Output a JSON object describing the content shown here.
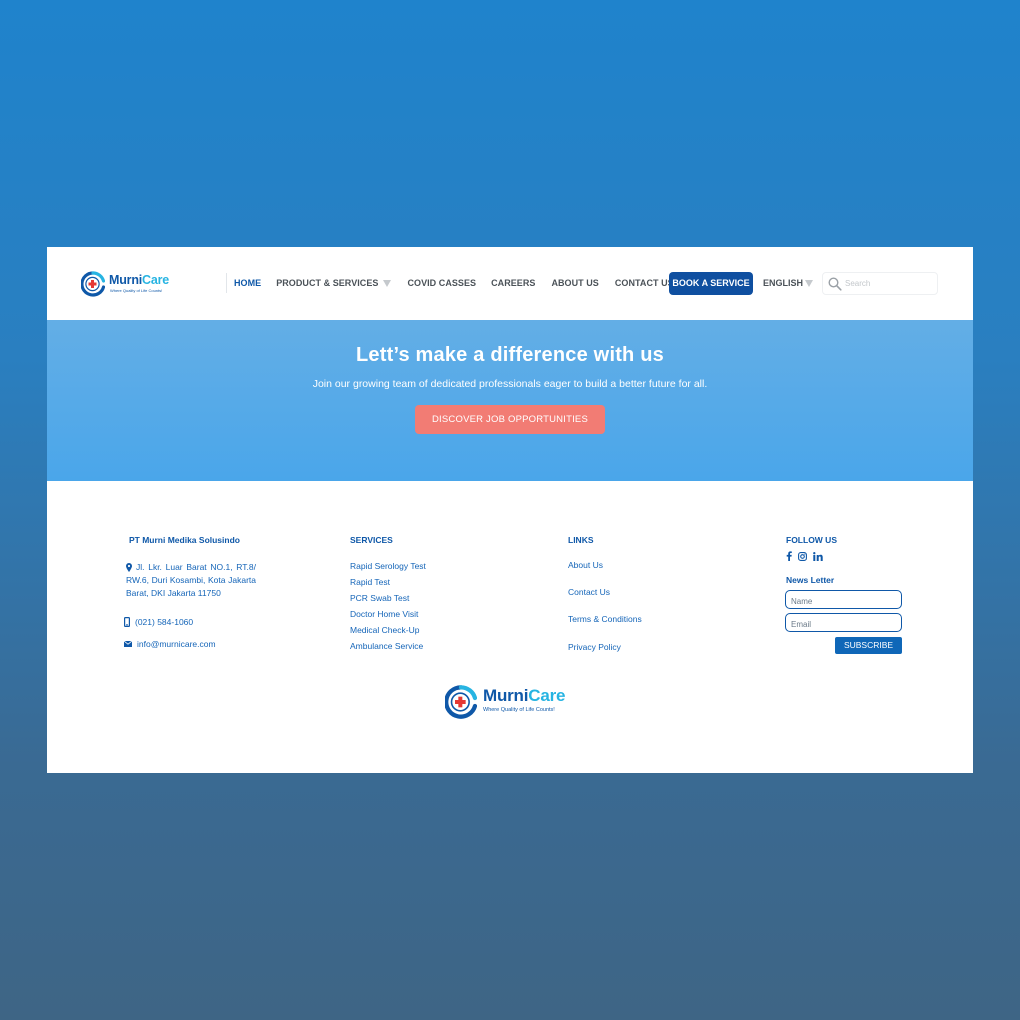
{
  "brand": {
    "name_part1": "Murni",
    "name_part2": "Care",
    "tagline": "Where Quality of Life Counts!"
  },
  "nav": {
    "items": [
      {
        "label": "HOME",
        "active": true
      },
      {
        "label": "PRODUCT & SERVICES",
        "dropdown": true
      },
      {
        "label": "COVID CASSES"
      },
      {
        "label": "CAREERS"
      },
      {
        "label": "ABOUT US"
      },
      {
        "label": "CONTACT US"
      }
    ],
    "book_label": "BOOK A SERVICE",
    "language": "ENGLISH",
    "search_placeholder": "Search"
  },
  "hero": {
    "title": "Lett’s make a difference with us",
    "subtitle": "Join our growing team of dedicated professionals eager to build a better future for all.",
    "cta": "DISCOVER JOB OPPORTUNITIES"
  },
  "footer": {
    "company": {
      "name": "PT Murni Medika Solusindo",
      "address": "Jl. Lkr. Luar Barat NO.1, RT.8/ RW.6, Duri Kosambi, Kota Jakarta Barat, DKI Jakarta 11750",
      "phone": "(021) 584-1060",
      "email": "info@murnicare.com"
    },
    "services": {
      "heading": "SERVICES",
      "items": [
        "Rapid Serology Test",
        "Rapid Test",
        "PCR Swab Test",
        "Doctor Home Visit",
        "Medical Check-Up",
        "Ambulance Service"
      ]
    },
    "links": {
      "heading": "LINKS",
      "items": [
        "About Us",
        "Contact Us",
        "Terms & Conditions",
        "Privacy Policy"
      ]
    },
    "follow": {
      "heading": "FOLLOW US",
      "icons": [
        "facebook-icon",
        "instagram-icon",
        "linkedin-icon"
      ]
    },
    "newsletter": {
      "heading": "News Letter",
      "name_placeholder": "Name",
      "email_placeholder": "Email",
      "subscribe": "SUBSCRIBE"
    }
  },
  "colors": {
    "primary": "#0f58a8",
    "accent": "#27b4e2",
    "hero": "#4aa6ea",
    "cta": "#f27c74",
    "logo_red": "#e53935"
  }
}
